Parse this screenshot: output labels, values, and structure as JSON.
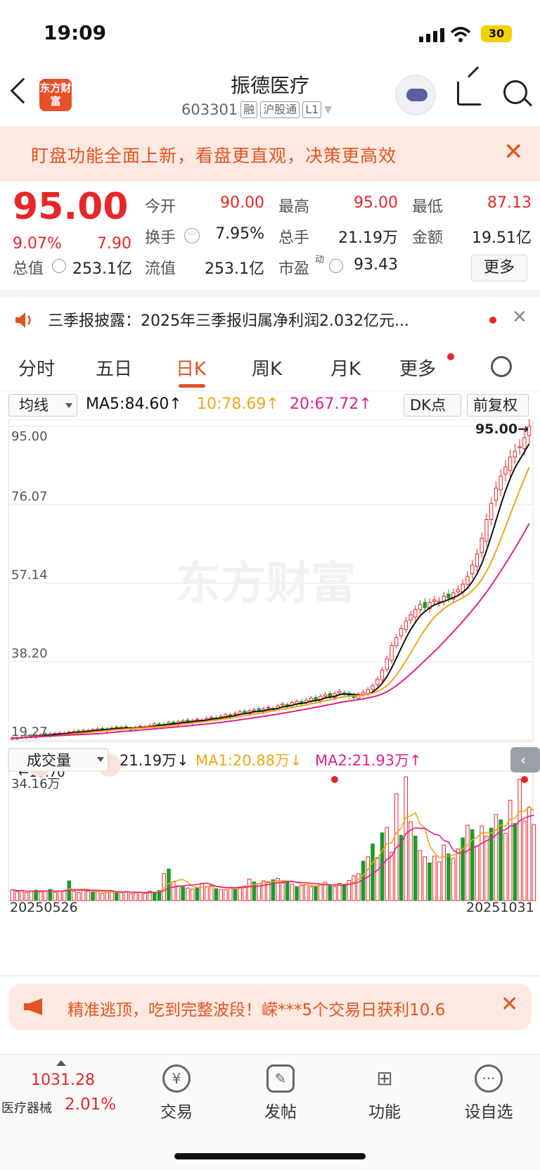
{
  "status_bar": {
    "time": "19:09",
    "battery": "30"
  },
  "header": {
    "title": "振德医疗",
    "code": "603301",
    "tags": [
      "融",
      "沪股通",
      "L1"
    ],
    "logo_text": "东方财富"
  },
  "banner": {
    "text": "盯盘功能全面上新，看盘更直观，决策更高效"
  },
  "quote": {
    "price": "95.00",
    "change_pct": "9.07%",
    "change_val": "7.90",
    "open_label": "今开",
    "open": "90.00",
    "high_label": "最高",
    "high": "95.00",
    "low_label": "最低",
    "low": "87.13",
    "turnover_label": "换手",
    "turnover": "7.95%",
    "volume_label": "总手",
    "volume": "21.19万",
    "amount_label": "金额",
    "amount": "19.51亿",
    "mktcap_label": "总值",
    "mktcap": "253.1亿",
    "float_label": "流值",
    "float": "253.1亿",
    "pe_label": "市盈",
    "pe_sup": "动",
    "pe": "93.43",
    "more": "更多"
  },
  "news": {
    "text": "三季报披露：2025年三季报归属净利润2.032亿元..."
  },
  "tabs": [
    "分时",
    "五日",
    "日K",
    "周K",
    "月K",
    "更多"
  ],
  "active_tab": "日K",
  "ma_bar": {
    "selector": "均线",
    "ma5": "MA5:84.60↑",
    "ma10": "10:78.69↑",
    "ma20": "20:67.72↑",
    "dk": "DK点",
    "adjust": "前复权"
  },
  "colors": {
    "up": "#e8262a",
    "down": "#1a9c2a",
    "ma5": "#111111",
    "ma10": "#f2a516",
    "ma20": "#e0218a",
    "accent": "#e2531f"
  },
  "chart_data": [
    {
      "type": "candlestick",
      "title": "",
      "y_ticks": [
        "95.00",
        "76.07",
        "57.14",
        "38.20",
        "19.27"
      ],
      "ylim": [
        19.27,
        95.0
      ],
      "last_price_label": "95.00→",
      "low_marker": "←19.70",
      "x_start": "20250526",
      "x_end": "20251031",
      "watermark": "东方财富",
      "close": [
        19.8,
        19.7,
        20.0,
        20.3,
        20.1,
        20.5,
        20.6,
        20.4,
        20.8,
        20.9,
        21.0,
        20.8,
        21.2,
        21.4,
        21.3,
        21.6,
        21.5,
        21.8,
        22.0,
        21.8,
        22.0,
        22.2,
        22.1,
        22.4,
        22.3,
        22.0,
        22.3,
        22.6,
        22.5,
        22.8,
        23.2,
        22.9,
        23.1,
        23.5,
        23.3,
        23.7,
        23.9,
        23.6,
        24.0,
        24.3,
        24.1,
        24.5,
        24.8,
        24.6,
        25.0,
        25.4,
        25.2,
        25.7,
        26.1,
        25.9,
        26.3,
        26.6,
        26.2,
        26.8,
        27.2,
        26.9,
        27.5,
        28.0,
        27.6,
        28.3,
        28.6,
        28.1,
        28.9,
        29.4,
        29.0,
        29.8,
        30.2,
        29.7,
        30.5,
        31.0,
        30.6,
        29.8,
        29.5,
        30.2,
        30.8,
        31.5,
        32.4,
        34.0,
        36.2,
        38.9,
        42.1,
        44.0,
        46.2,
        48.0,
        49.5,
        50.8,
        52.0,
        51.2,
        52.5,
        53.1,
        52.8,
        54.0,
        53.6,
        54.8,
        55.6,
        56.9,
        58.8,
        61.5,
        64.2,
        68.0,
        72.5,
        76.4,
        80.1,
        83.0,
        85.2,
        87.6,
        89.0,
        90.1,
        92.3,
        95.0
      ],
      "ma_legend": [
        "MA5",
        "MA10",
        "MA20"
      ]
    },
    {
      "type": "bar",
      "title": "",
      "selector": "成交量",
      "current": "21.19万↓",
      "ma1": "MA1:20.88万↓",
      "ma2": "MA2:21.93万↑",
      "y_top": "34.16万",
      "values": [
        3.0,
        2.5,
        2.8,
        2.2,
        2.6,
        2.9,
        2.4,
        2.7,
        3.1,
        2.3,
        2.6,
        2.8,
        5.5,
        2.5,
        2.2,
        2.9,
        2.6,
        2.4,
        2.7,
        2.0,
        2.3,
        2.6,
        2.4,
        2.2,
        2.5,
        1.9,
        2.1,
        2.3,
        2.0,
        2.6,
        2.2,
        2.8,
        7.5,
        8.8,
        5.2,
        4.1,
        3.8,
        3.5,
        3.2,
        3.6,
        4.8,
        3.9,
        4.2,
        3.3,
        3.1,
        3.0,
        3.7,
        3.4,
        3.8,
        4.0,
        6.0,
        5.2,
        4.8,
        5.5,
        5.0,
        5.8,
        6.2,
        4.9,
        5.4,
        4.6,
        3.9,
        4.2,
        4.4,
        3.8,
        4.0,
        4.6,
        5.1,
        4.3,
        3.9,
        4.8,
        4.5,
        5.6,
        6.9,
        7.5,
        11.0,
        12.2,
        15.8,
        12.0,
        18.9,
        20.4,
        13.5,
        29.8,
        18.2,
        34.5,
        22.0,
        18.0,
        14.0,
        12.2,
        10.5,
        12.4,
        10.8,
        15.5,
        13.0,
        11.8,
        14.4,
        17.5,
        21.0,
        19.8,
        15.2,
        20.8,
        18.0,
        20.2,
        24.0,
        22.5,
        18.8,
        28.0,
        21.5,
        33.8,
        22.2,
        26.0,
        21.19
      ],
      "down_days": [
        5,
        8,
        12,
        17,
        22,
        30,
        31,
        33,
        36,
        39,
        43,
        47,
        51,
        55,
        58,
        60,
        64,
        67,
        70,
        74,
        76,
        78,
        82,
        85,
        88,
        92,
        95,
        97,
        101,
        103,
        106
      ]
    }
  ],
  "promo": {
    "text": "精准逃顶，吃到完整波段！嵘***5个交易日获利10.6"
  },
  "bottom": {
    "index_value": "1031.28",
    "index_name": "医疗器械",
    "index_pct": "2.01%",
    "items": [
      "交易",
      "发帖",
      "功能",
      "设自选"
    ]
  }
}
